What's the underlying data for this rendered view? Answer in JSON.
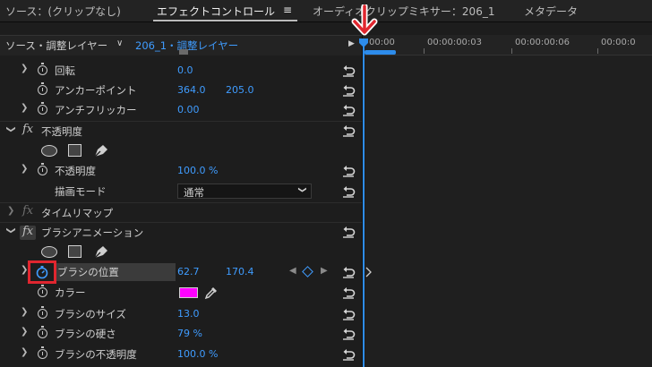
{
  "tabs": {
    "source": "ソース：(クリップなし)",
    "effect_controls": "エフェクトコントロール",
    "menu_icon": "≡",
    "audio_mixer": "オーディオクリップミキサー：206_1",
    "metadata": "メタデータ"
  },
  "source_bar": {
    "source_label": "ソース・調整レイヤー",
    "chevron": "∨",
    "clip_label": "206_1・調整レイヤー",
    "play": "▶"
  },
  "timeline": {
    "ticks": [
      "00:00",
      "00:00:00:03",
      "00:00:00:06",
      "00:00:0"
    ]
  },
  "properties": {
    "rotation": {
      "label": "回転",
      "value": "0.0"
    },
    "anchor": {
      "label": "アンカーポイント",
      "x": "364.0",
      "y": "205.0"
    },
    "antiflicker": {
      "label": "アンチフリッカー",
      "value": "0.00"
    },
    "opacity_section": {
      "fx": "fx",
      "label": "不透明度"
    },
    "opacity": {
      "label": "不透明度",
      "value": "100.0 %"
    },
    "blend_mode": {
      "label": "描画モード",
      "value": "通常"
    },
    "time_remap": {
      "fx": "fx",
      "label": "タイムリマップ"
    },
    "brush_section": {
      "fx": "fx",
      "label": "ブラシアニメーション"
    },
    "brush_position": {
      "label": "ブラシの位置",
      "x": "62.7",
      "y": "170.4"
    },
    "color": {
      "label": "カラー",
      "swatch": "#ff00ff"
    },
    "brush_size": {
      "label": "ブラシのサイズ",
      "value": "13.0"
    },
    "brush_hardness": {
      "label": "ブラシの硬さ",
      "value": "79 %"
    },
    "brush_opacity": {
      "label": "ブラシの不透明度",
      "value": "100.0 %"
    }
  },
  "colors": {
    "accent": "#3f9cff",
    "playhead": "#2d8ceb",
    "highlight": "#e0262f"
  }
}
